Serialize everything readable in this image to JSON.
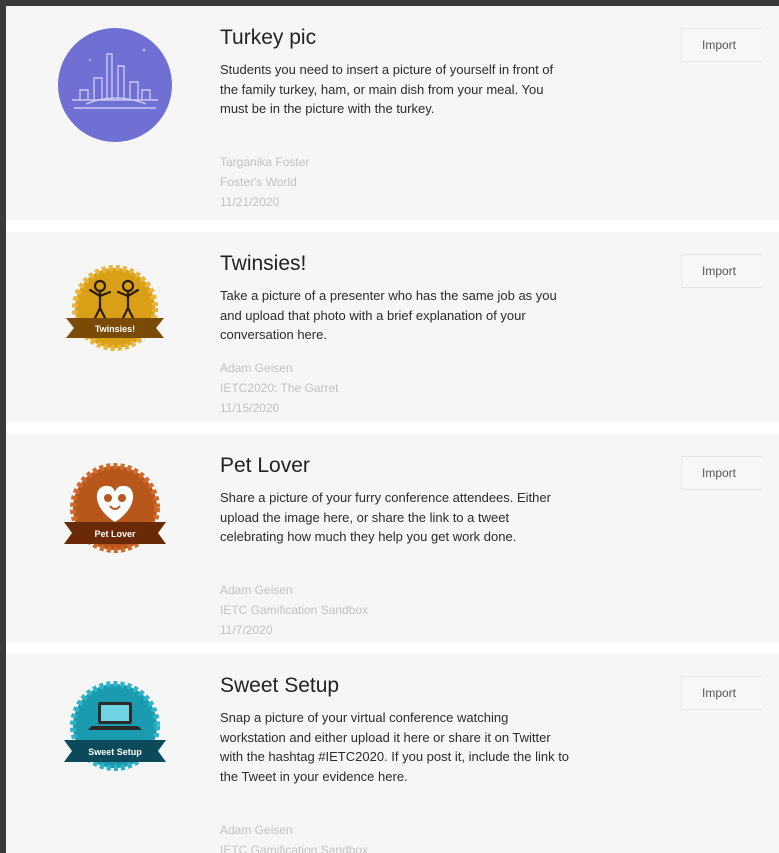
{
  "challenges": [
    {
      "title": "Turkey pic",
      "description": "Students you need to insert a picture of yourself in front of the family turkey, ham, or main dish from your meal. You must be in the picture with the turkey.",
      "author": "Targanika Foster",
      "source": "Foster's World",
      "date": "11/21/2020",
      "import_label": "Import",
      "badge": {
        "icon": "cityscape-icon",
        "color": "#6f6fd4",
        "label": ""
      }
    },
    {
      "title": "Twinsies!",
      "description": "Take a picture of a presenter who has the same job as you and upload that photo with a brief explanation of your conversation here.",
      "author": "Adam Geisen",
      "source": "IETC2020: The Garret",
      "date": "11/15/2020",
      "import_label": "Import",
      "badge": {
        "icon": "two-people-icon",
        "color": "#d9a017",
        "label": "Twinsies!"
      }
    },
    {
      "title": "Pet Lover",
      "description": "Share a picture of your furry conference attendees. Either upload the image here, or share the link to a tweet celebrating how much they help you get work done.",
      "author": "Adam Geisen",
      "source": "IETC Gamification Sandbox",
      "date": "11/7/2020",
      "import_label": "Import",
      "badge": {
        "icon": "pet-heart-icon",
        "color": "#b8571c",
        "label": "Pet Lover"
      }
    },
    {
      "title": "Sweet Setup",
      "description": "Snap a picture of your virtual conference watching workstation and either upload it here or share it on Twitter with the hashtag #IETC2020. If you post it, include the link to the Tweet in your evidence here.",
      "author": "Adam Geisen",
      "source": "IETC Gamification Sandbox",
      "date": "",
      "import_label": "Import",
      "badge": {
        "icon": "laptop-icon",
        "color": "#1a9bb0",
        "label": "Sweet Setup"
      }
    }
  ]
}
